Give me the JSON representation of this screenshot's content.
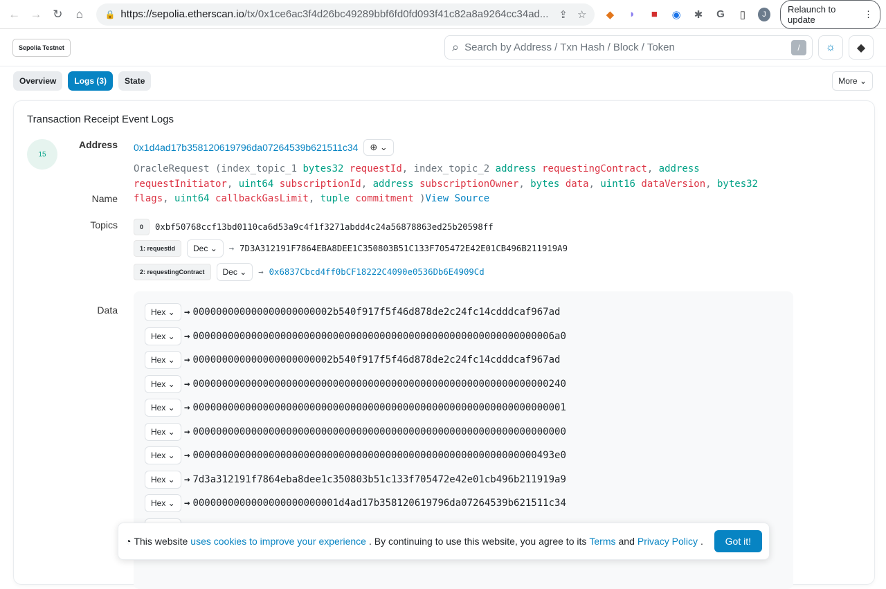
{
  "browser": {
    "url_host": "https://sepolia.etherscan.io",
    "url_path": "/tx/0x1ce6ac3f4d26bc49289bbf6fd0fd093f41c82a8a9264cc34ad...",
    "relaunch": "Relaunch to update",
    "avatar": "J"
  },
  "header": {
    "network": "Sepolia Testnet",
    "search_placeholder": "Search by Address / Txn Hash / Block / Token",
    "slash": "/"
  },
  "tabs": [
    {
      "label": "Overview"
    },
    {
      "label": "Logs (3)"
    },
    {
      "label": "State"
    }
  ],
  "more": "More",
  "card": {
    "title": "Transaction Receipt Event Logs",
    "log_index": "15",
    "address_label": "Address",
    "address": "0x1d4ad17b358120619796da07264539b621511c34",
    "name_label": "Name",
    "topics_label": "Topics",
    "data_label": "Data",
    "event": {
      "name": "OracleRequest",
      "params": [
        {
          "prefix": "index_topic_1 ",
          "type": "bytes32",
          "var": "requestId"
        },
        {
          "prefix": "index_topic_2 ",
          "type": "address",
          "var": "requestingContract"
        },
        {
          "prefix": "",
          "type": "address",
          "var": "requestInitiator"
        },
        {
          "prefix": "",
          "type": "uint64",
          "var": "subscriptionId"
        },
        {
          "prefix": "",
          "type": "address",
          "var": "subscriptionOwner"
        },
        {
          "prefix": "",
          "type": "bytes",
          "var": "data"
        },
        {
          "prefix": "",
          "type": "uint16",
          "var": "dataVersion"
        },
        {
          "prefix": "",
          "type": "bytes32",
          "var": "flags"
        },
        {
          "prefix": "",
          "type": "uint64",
          "var": "callbackGasLimit"
        },
        {
          "prefix": "",
          "type": "tuple",
          "var": "commitment"
        }
      ],
      "view_source": "View Source"
    },
    "topics": [
      {
        "label": "0",
        "value": "0xbf50768ccf13bd0110ca6d53a9c4f1f3271abdd4c24a56878863ed25b20598ff"
      },
      {
        "label": "1: requestId",
        "format": "Dec",
        "value": "7D3A312191F7864EBA8DEE1C350803B51C133F705472E42E01CB496B211919A9"
      },
      {
        "label": "2: requestingContract",
        "format": "Dec",
        "value": "0x6837Cbcd4ff0bCF18222C4090e0536Db6E4909Cd"
      }
    ],
    "data": [
      "000000000000000000000002b540f917f5f46d878de2c24fc14cdddcaf967ad",
      "00000000000000000000000000000000000000000000000000000000000006a0",
      "000000000000000000000002b540f917f5f46d878de2c24fc14cdddcaf967ad",
      "0000000000000000000000000000000000000000000000000000000000000240",
      "0000000000000000000000000000000000000000000000000000000000000001",
      "0000000000000000000000000000000000000000000000000000000000000000",
      "00000000000000000000000000000000000000000000000000000000000493e0",
      "7d3a312191f7864eba8dee1c350803b51c133f705472e42e01cb496b211919a9",
      "0000000000000000000000001d4ad17b358120619796da07264539b621511c34"
    ],
    "data_format": "Hex"
  },
  "cookie": {
    "pre": "This website",
    "link1": "uses cookies to improve your experience",
    "mid": ". By continuing to use this website, you agree to its",
    "terms": "Terms",
    "and": "and",
    "privacy": "Privacy Policy",
    "end": ".",
    "button": "Got it!"
  }
}
